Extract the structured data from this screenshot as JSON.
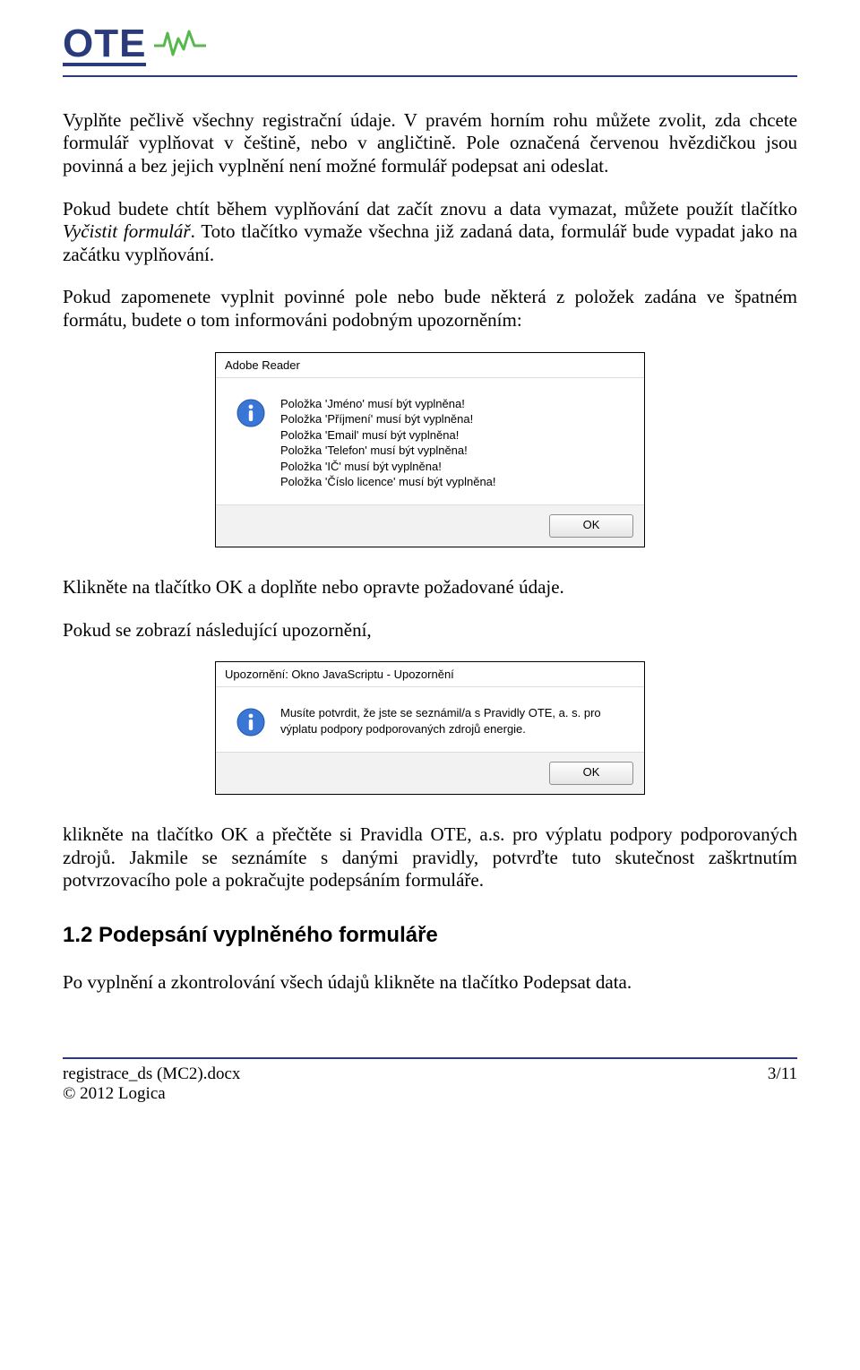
{
  "logo": {
    "text": "OTE"
  },
  "p1_a": "Vyplňte pečlivě všechny registrační údaje. V pravém horním rohu můžete zvolit, zda chcete formulář vyplňovat v češtině, nebo v angličtině. Pole označená červenou hvězdičkou jsou povinná a bez jejich vyplnění není možné formulář podepsat ani odeslat.",
  "p2_a": "Pokud budete chtít během vyplňování dat začít znovu a data vymazat, můžete použít tlačítko ",
  "p2_em": "Vyčistit formulář",
  "p2_b": ". Toto tlačítko vymaže všechna již zadaná data, formulář bude vypadat jako na začátku vyplňování.",
  "p3": "Pokud zapomenete vyplnit povinné pole nebo bude některá z položek zadána ve špatném formátu, budete o tom informováni podobným upozorněním:",
  "dialog1": {
    "title": "Adobe Reader",
    "lines": [
      "Položka 'Jméno' musí být vyplněna!",
      "Položka 'Příjmení' musí být vyplněna!",
      "Položka 'Email' musí být vyplněna!",
      "Položka 'Telefon' musí být vyplněna!",
      "Položka 'IČ' musí být vyplněna!",
      "Položka 'Číslo licence' musí být vyplněna!"
    ],
    "ok": "OK"
  },
  "p4": "Klikněte na tlačítko OK a doplňte nebo opravte požadované údaje.",
  "p5": "Pokud se zobrazí následující upozornění,",
  "dialog2": {
    "title": "Upozornění: Okno JavaScriptu - Upozornění",
    "msg": "Musíte potvrdit, že jste se seznámil/a s Pravidly OTE, a. s. pro výplatu podpory podporovaných zdrojů energie.",
    "ok": "OK"
  },
  "p6": "klikněte na tlačítko OK a přečtěte si Pravidla OTE, a.s. pro výplatu podpory podporovaných zdrojů. Jakmile se seznámíte s danými pravidly, potvrďte tuto skutečnost zaškrtnutím potvrzovacího pole a pokračujte podepsáním formuláře.",
  "heading": "1.2  Podepsání vyplněného formuláře",
  "p7": "Po vyplnění a zkontrolování všech údajů klikněte na tlačítko Podepsat data.",
  "footer": {
    "filename": "registrace_ds (MC2).docx",
    "copyright": "© 2012 Logica",
    "page": "3/11"
  }
}
